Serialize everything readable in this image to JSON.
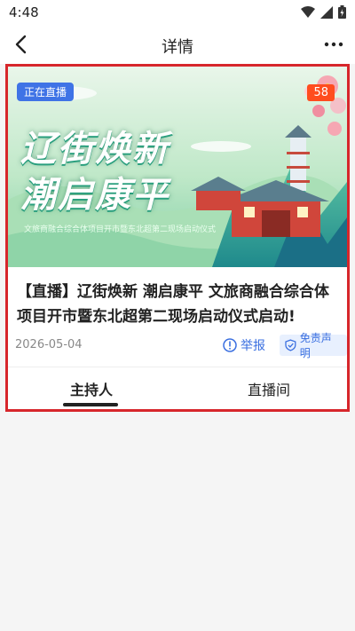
{
  "status": {
    "time": "4:48"
  },
  "nav": {
    "title": "详情"
  },
  "banner": {
    "live_tag": "正在直播",
    "viewers": "58",
    "title_line1": "辽街焕新",
    "title_line2": "潮启康平",
    "subtitle": "文旅商融合综合体项目开市暨东北超第二现场启动仪式"
  },
  "article": {
    "headline": "【直播】辽街焕新 潮启康平 文旅商融合综合体项目开市暨东北超第二现场启动仪式启动!",
    "date": "2026-05-04",
    "report_label": "举报",
    "disclaimer_label": "免责声明"
  },
  "tabs": [
    {
      "label": "主持人"
    },
    {
      "label": "直播间"
    }
  ],
  "colors": {
    "accent_blue": "#3a6fe0",
    "live_blue": "#3f73e6",
    "badge_red": "#ff4d1f",
    "highlight_border": "#d7262b"
  }
}
